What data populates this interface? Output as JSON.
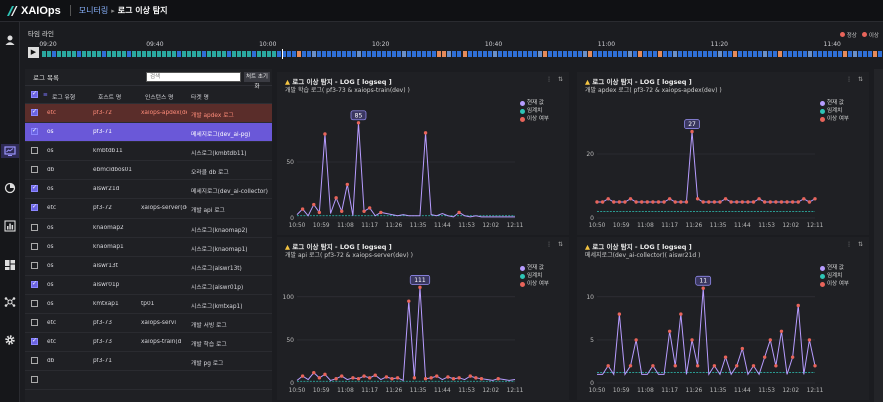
{
  "app": {
    "name": "XAIOps",
    "breadcrumb_root": "모니터링",
    "breadcrumb_current": "로그 이상 탐지"
  },
  "colors": {
    "accent": "#6a63e0",
    "normal": "#2aa8a0",
    "anomaly": "#e8645a",
    "timeline_blue": "#2f6fd6",
    "current_line": "#b79cff",
    "threshold": "#2ec4b6"
  },
  "nav_icons": [
    "user-icon",
    "monitor-icon",
    "pie-chart-icon",
    "bar-chart-icon",
    "dashboard-icon",
    "network-icon",
    "settings-icon"
  ],
  "timeline": {
    "title": "타임 라인",
    "legend": [
      {
        "label": "정상",
        "color": "#2aa8a0"
      },
      {
        "label": "이상",
        "color": "#e8645a"
      }
    ],
    "ticks": [
      "09:20",
      "09:40",
      "10:00",
      "10:20",
      "10:40",
      "11:00",
      "11:20",
      "11:40"
    ]
  },
  "log_list": {
    "title": "로그 목록",
    "search_placeholder": "검색",
    "reset_label": "처트 초기화",
    "columns": [
      "로그 유형",
      "호스트 명",
      "인스턴스 명",
      "타겟 명"
    ],
    "rows": [
      {
        "type": "etc",
        "host": "pf3-72",
        "instance": "xaiops-apdex(dev)",
        "target": "개발 apdex 로그",
        "checked": true,
        "state": "red"
      },
      {
        "type": "os",
        "host": "pf3-71",
        "instance": "",
        "target": "메세지로그(dev_ai-pg)",
        "checked": true,
        "state": "purple"
      },
      {
        "type": "os",
        "host": "kmbtdb11",
        "instance": "",
        "target": "시스로그(kmbtdb11)",
        "checked": false,
        "state": ""
      },
      {
        "type": "db",
        "host": "ebmcidbos01",
        "instance": "",
        "target": "오라클 db 로그",
        "checked": false,
        "state": ""
      },
      {
        "type": "os",
        "host": "aiswr21d",
        "instance": "",
        "target": "메세지로그(dev_ai-collector)",
        "checked": true,
        "state": ""
      },
      {
        "type": "etc",
        "host": "pf3-72",
        "instance": "xaiops-server(dev)",
        "target": "개발 api 로그",
        "checked": true,
        "state": ""
      },
      {
        "type": "os",
        "host": "knaomap2",
        "instance": "",
        "target": "시스로그(knaomap2)",
        "checked": false,
        "state": ""
      },
      {
        "type": "os",
        "host": "knaomap1",
        "instance": "",
        "target": "시스로그(knaomap1)",
        "checked": false,
        "state": ""
      },
      {
        "type": "os",
        "host": "aiswr13t",
        "instance": "",
        "target": "시스로그(aiswr13t)",
        "checked": false,
        "state": ""
      },
      {
        "type": "os",
        "host": "aiswr01p",
        "instance": "",
        "target": "시스로그(aiswr01p)",
        "checked": true,
        "state": ""
      },
      {
        "type": "os",
        "host": "kmtxap1",
        "instance": "tp01",
        "target": "시스로그(kmtxap1)",
        "checked": false,
        "state": ""
      },
      {
        "type": "etc",
        "host": "pf3-73",
        "instance": "xaiops-servi",
        "target": "개발 서빙 로그",
        "checked": false,
        "state": ""
      },
      {
        "type": "etc",
        "host": "pf3-73",
        "instance": "xaiops-train(d",
        "target": "개발 학습 로그",
        "checked": true,
        "state": ""
      },
      {
        "type": "db",
        "host": "pf3-71",
        "instance": "",
        "target": "개발 pg 로그",
        "checked": false,
        "state": ""
      },
      {
        "type": "",
        "host": "",
        "instance": "",
        "target": "",
        "checked": false,
        "state": ""
      }
    ]
  },
  "legend_labels": [
    "현재 값",
    "임계치",
    "이상 여부"
  ],
  "chart_data": [
    {
      "type": "line",
      "title": "로그 이상 탐지 - LOG [ logseq ]",
      "subtitle": "개발 학습 로그( pf3-73 & xaiops-train(dev) )",
      "x_ticks": [
        "10:50",
        "10:59",
        "11:08",
        "11:17",
        "11:26",
        "11:35",
        "11:44",
        "11:53",
        "12:02",
        "12:11"
      ],
      "y_ticks": [
        "0",
        "50"
      ],
      "ylim": [
        0,
        100
      ],
      "peak_label": "85",
      "series": [
        {
          "name": "현재 값",
          "values": [
            3,
            8,
            2,
            12,
            5,
            75,
            4,
            18,
            6,
            30,
            2,
            85,
            6,
            9,
            2,
            5,
            4,
            3,
            2,
            3,
            2,
            2,
            2,
            76,
            3,
            2,
            4,
            2,
            1,
            5,
            2,
            1,
            2,
            1,
            1,
            1,
            1,
            1,
            1,
            1
          ]
        },
        {
          "name": "임계치",
          "values": [
            2,
            2,
            2,
            2,
            2,
            2,
            2,
            2,
            2,
            2,
            2,
            2,
            2,
            2,
            2,
            2,
            2,
            2,
            2,
            2,
            2,
            2,
            2,
            2,
            2,
            2,
            2,
            2,
            2,
            2,
            2,
            2,
            2,
            2,
            2,
            2,
            2,
            2,
            2,
            2
          ]
        }
      ]
    },
    {
      "type": "line",
      "title": "로그 이상 탐지 - LOG [ logseq ]",
      "subtitle": "개발 apdex 로그( pf3-72 & xaiops-apdex(dev) )",
      "x_ticks": [
        "10:50",
        "10:59",
        "11:08",
        "11:17",
        "11:26",
        "11:35",
        "11:44",
        "11:53",
        "12:02",
        "12:11"
      ],
      "y_ticks": [
        "0",
        "20"
      ],
      "ylim": [
        0,
        35
      ],
      "peak_label": "27",
      "series": [
        {
          "name": "현재 값",
          "values": [
            5,
            5,
            6,
            5,
            5,
            5,
            6,
            5,
            5,
            5,
            5,
            5,
            5,
            6,
            5,
            5,
            5,
            27,
            6,
            5,
            5,
            5,
            5,
            6,
            5,
            5,
            5,
            5,
            5,
            6,
            5,
            5,
            5,
            5,
            5,
            5,
            5,
            6,
            5,
            6
          ]
        },
        {
          "name": "임계치",
          "values": [
            2,
            2,
            2,
            2,
            2,
            2,
            2,
            2,
            2,
            2,
            2,
            2,
            2,
            2,
            2,
            2,
            2,
            2,
            2,
            2,
            2,
            2,
            2,
            2,
            2,
            2,
            2,
            2,
            2,
            2,
            2,
            2,
            2,
            2,
            2,
            2,
            2,
            2,
            2,
            2
          ]
        }
      ]
    },
    {
      "type": "line",
      "title": "로그 이상 탐지 - LOG [ logseq ]",
      "subtitle": "개발 api 로그( pf3-72 & xaiops-server(dev) )",
      "x_ticks": [
        "10:50",
        "10:59",
        "11:08",
        "11:17",
        "11:26",
        "11:35",
        "11:44",
        "11:53",
        "12:02",
        "12:11"
      ],
      "y_ticks": [
        "0",
        "50",
        "100"
      ],
      "ylim": [
        0,
        130
      ],
      "peak_label": "111",
      "series": [
        {
          "name": "현재 값",
          "values": [
            3,
            8,
            4,
            12,
            6,
            10,
            3,
            5,
            8,
            4,
            6,
            5,
            8,
            6,
            9,
            4,
            7,
            5,
            6,
            3,
            95,
            6,
            111,
            5,
            6,
            8,
            4,
            7,
            5,
            6,
            4,
            8,
            6,
            5,
            4,
            3,
            5,
            4,
            3,
            4
          ]
        },
        {
          "name": "임계치",
          "values": [
            2,
            2,
            2,
            2,
            2,
            2,
            2,
            2,
            2,
            2,
            2,
            2,
            2,
            2,
            2,
            2,
            2,
            2,
            2,
            2,
            2,
            2,
            2,
            2,
            2,
            2,
            2,
            2,
            2,
            2,
            2,
            2,
            2,
            2,
            2,
            2,
            2,
            2,
            2,
            2
          ]
        }
      ]
    },
    {
      "type": "line",
      "title": "로그 이상 탐지 - LOG [ logseq ]",
      "subtitle": "메세지로그(dev_ai-collector)( aiswr21d )",
      "x_ticks": [
        "10:50",
        "10:59",
        "11:08",
        "11:17",
        "11:26",
        "11:35",
        "11:44",
        "11:53",
        "12:02",
        "12:11"
      ],
      "y_ticks": [
        "0",
        "5",
        "10"
      ],
      "ylim": [
        0,
        13
      ],
      "peak_label": "11",
      "series": [
        {
          "name": "현재 값",
          "values": [
            1,
            1,
            2,
            1,
            8,
            1,
            2,
            5,
            1,
            1,
            2,
            1,
            1,
            6,
            2,
            8,
            1,
            5,
            2,
            11,
            1,
            2,
            1,
            3,
            1,
            2,
            4,
            1,
            2,
            1,
            3,
            5,
            2,
            6,
            1,
            3,
            9,
            1,
            5,
            2
          ]
        },
        {
          "name": "임계치",
          "values": [
            1.2,
            1.2,
            1.2,
            1.2,
            1.2,
            1.2,
            1.2,
            1.2,
            1.2,
            1.2,
            1.2,
            1.2,
            1.2,
            1.2,
            1.2,
            1.2,
            1.2,
            1.2,
            1.2,
            1.2,
            1.2,
            1.2,
            1.2,
            1.2,
            1.2,
            1.2,
            1.2,
            1.2,
            1.2,
            1.2,
            1.2,
            1.2,
            1.2,
            1.2,
            1.2,
            1.2,
            1.2,
            1.2,
            1.2,
            1.2
          ]
        }
      ]
    }
  ]
}
